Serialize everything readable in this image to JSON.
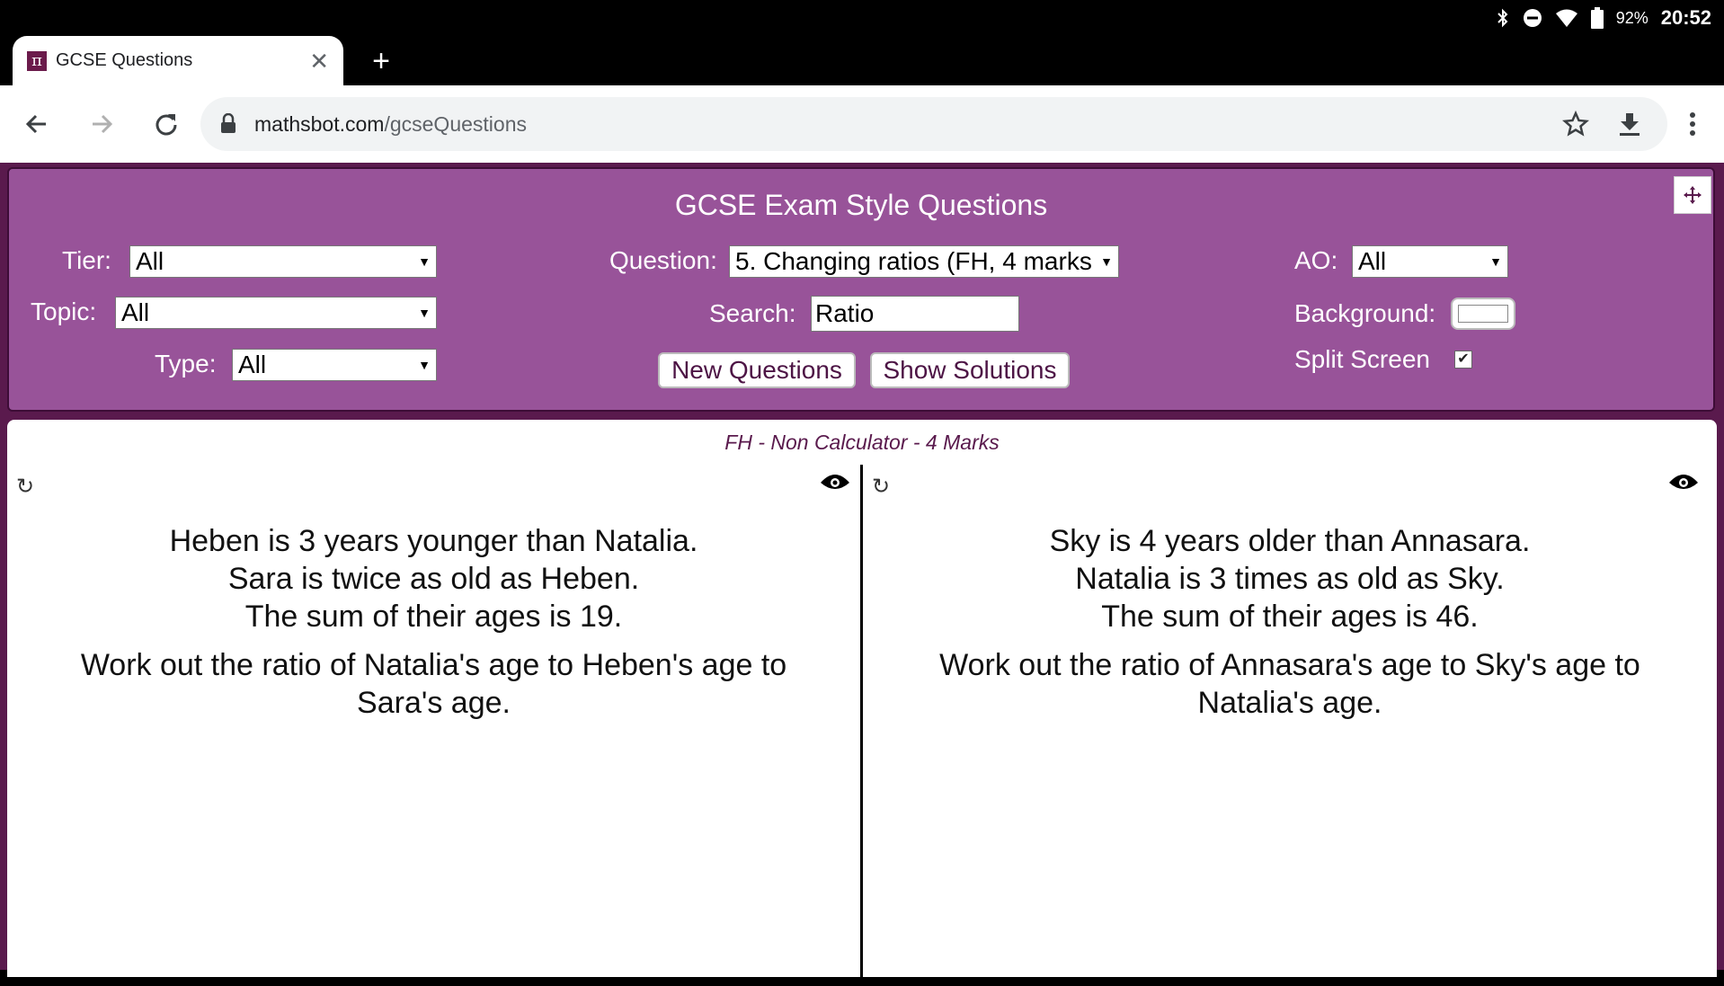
{
  "status_bar": {
    "battery_pct": "92%",
    "time": "20:52",
    "icons": [
      "bluetooth-icon",
      "do-not-disturb-icon",
      "wifi-icon",
      "battery-icon"
    ]
  },
  "browser": {
    "tab_title": "GCSE Questions",
    "favicon_glyph": "π",
    "url_domain": "mathsbot.com",
    "url_path": "/gcseQuestions"
  },
  "panel": {
    "title": "GCSE Exam Style Questions",
    "tier": {
      "label": "Tier:",
      "value": "All"
    },
    "topic": {
      "label": "Topic:",
      "value": "All"
    },
    "type": {
      "label": "Type:",
      "value": "All"
    },
    "question": {
      "label": "Question:",
      "value": "5. Changing ratios (FH, 4 marks"
    },
    "search": {
      "label": "Search:",
      "value": "Ratio"
    },
    "new_questions": "New Questions",
    "show_solutions": "Show Solutions",
    "ao": {
      "label": "AO:",
      "value": "All"
    },
    "background": {
      "label": "Background:",
      "color": "#ffffff"
    },
    "split_screen": {
      "label": "Split Screen",
      "checked": true,
      "mark": "✔"
    }
  },
  "content": {
    "meta": "FH - Non Calculator - 4 Marks",
    "refresh_glyph": "↻",
    "left": {
      "lines": [
        "Heben is 3 years younger than Natalia.",
        "Sara is twice as old as Heben.",
        "The sum of their ages is 19."
      ],
      "task": "Work out the ratio of Natalia's age to Heben's age to Sara's age."
    },
    "right": {
      "lines": [
        "Sky is 4 years older than Annasara.",
        "Natalia is 3 times as old as Sky.",
        "The sum of their ages is 46."
      ],
      "task": "Work out the ratio of Annasara's age to Sky's age to Natalia's age."
    }
  },
  "colors": {
    "panel_bg": "#985399",
    "page_bg": "#5a1a4d",
    "accent_text": "#4d1445"
  }
}
